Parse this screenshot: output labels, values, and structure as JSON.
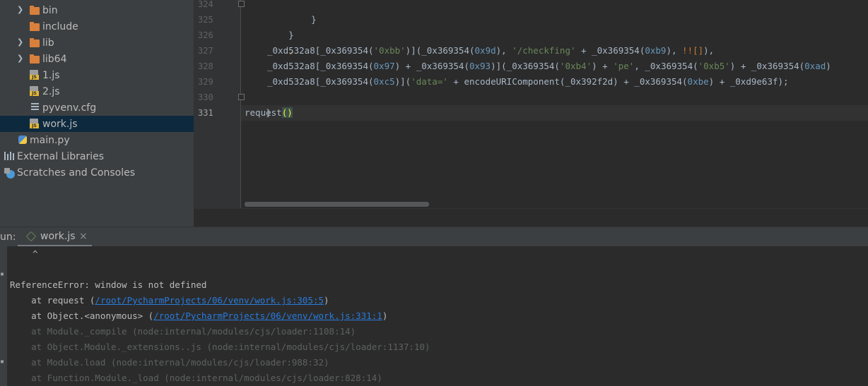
{
  "project_tree": {
    "items": [
      {
        "label": "bin",
        "kind": "folder",
        "collapsed": true
      },
      {
        "label": "include",
        "kind": "folder"
      },
      {
        "label": "lib",
        "kind": "folder",
        "collapsed": true
      },
      {
        "label": "lib64",
        "kind": "folder-link",
        "collapsed": true
      },
      {
        "label": "1.js",
        "kind": "js-file"
      },
      {
        "label": "2.js",
        "kind": "js-file"
      },
      {
        "label": "pyvenv.cfg",
        "kind": "config-file"
      },
      {
        "label": "work.js",
        "kind": "js-file",
        "selected": true
      },
      {
        "label": "main.py",
        "kind": "python-file"
      },
      {
        "label": "External Libraries",
        "kind": "libraries"
      },
      {
        "label": "Scratches and Consoles",
        "kind": "scratches"
      }
    ]
  },
  "editor": {
    "line_numbers": [
      "324",
      "325",
      "326",
      "327",
      "328",
      "329",
      "330",
      "331"
    ],
    "current_line": "331",
    "code": {
      "l324": "}",
      "l325": "}",
      "l326": ",",
      "l327_a": "_0xd532a8[_0x369354(",
      "l327_b": "'0xbb'",
      "l327_c": ")](_0x369354(",
      "l327_d": "0x9d",
      "l327_e": "), ",
      "l327_f": "'/checkfing'",
      "l327_g": " + _0x369354(",
      "l327_h": "0xb9",
      "l327_i": "), ",
      "l327_j": "!![]",
      "l327_k": "),",
      "l328_a": "_0xd532a8[_0x369354(",
      "l328_b": "0x97",
      "l328_c": ") + _0x369354(",
      "l328_d": "0x93",
      "l328_e": ")](_0x369354(",
      "l328_f": "'0xb4'",
      "l328_g": ") + ",
      "l328_h": "'pe'",
      "l328_i": ", _0x369354(",
      "l328_j": "'0xb5'",
      "l328_k": ") + _0x369354(",
      "l328_l": "0xad",
      "l328_m": ")",
      "l329_a": "_0xd532a8[_0x369354(",
      "l329_b": "0xc5",
      "l329_c": ")](",
      "l329_d": "'data='",
      "l329_e": " + encodeURIComponent(_0x392f2d) + _0x369354(",
      "l329_f": "0xbe",
      "l329_g": ") + _0xd9e63f);",
      "l330": "}",
      "l331_a": "request",
      "l331_b": "()"
    }
  },
  "run": {
    "label": "un:",
    "tab_label": "work.js",
    "tab_close": "×",
    "console": {
      "caret": "^",
      "error": "ReferenceError: window is not defined",
      "frame1_prefix": "    at request (",
      "frame1_link": "/root/PycharmProjects/06/venv/work.js:305:5",
      "frame1_suffix": ")",
      "frame2_prefix": "    at Object.<anonymous> (",
      "frame2_link": "/root/PycharmProjects/06/venv/work.js:331:1",
      "frame2_suffix": ")",
      "frame3": "    at Module._compile (node:internal/modules/cjs/loader:1108:14)",
      "frame4": "    at Object.Module._extensions..js (node:internal/modules/cjs/loader:1137:10)",
      "frame5": "    at Module.load (node:internal/modules/cjs/loader:988:32)",
      "frame6": "    at Function.Module._load (node:internal/modules/cjs/loader:828:14)"
    }
  },
  "colors": {
    "panel_bg": "#3c3f41",
    "editor_bg": "#2b2b2b",
    "selection": "#0d293e",
    "string": "#6a8759",
    "number": "#6897bb",
    "keyword": "#cc7832",
    "link": "#287bde"
  }
}
